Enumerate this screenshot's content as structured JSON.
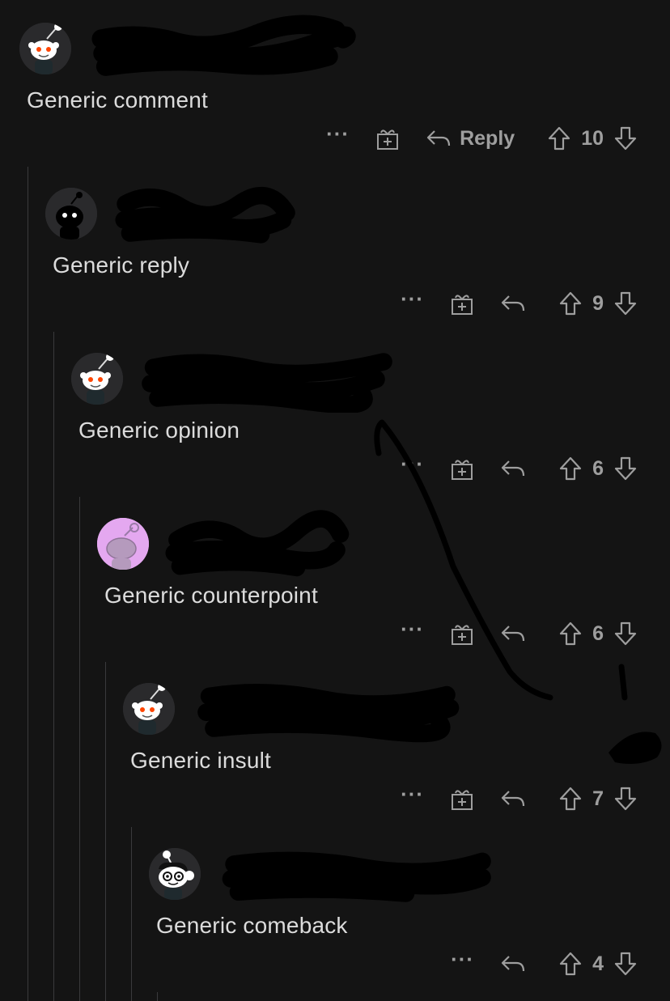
{
  "comments": [
    {
      "text": "Generic comment",
      "score": "10",
      "reply_label": "Reply",
      "more": "···",
      "avatar": "snoo-default-icon",
      "avatar_bg": "#2a2a2c"
    },
    {
      "text": "Generic reply",
      "score": "9",
      "reply_label": "",
      "more": "···",
      "avatar": "snoo-black-icon",
      "avatar_bg": "#2a2a2c"
    },
    {
      "text": "Generic opinion",
      "score": "6",
      "reply_label": "",
      "more": "···",
      "avatar": "snoo-default-icon",
      "avatar_bg": "#2a2a2c"
    },
    {
      "text": "Generic counterpoint",
      "score": "6",
      "reply_label": "",
      "more": "···",
      "avatar": "snoo-silhouette-icon",
      "avatar_bg": "#e4a8f0"
    },
    {
      "text": "Generic insult",
      "score": "7",
      "reply_label": "",
      "more": "···",
      "avatar": "snoo-default-icon",
      "avatar_bg": "#2a2a2c"
    },
    {
      "text": "Generic comeback",
      "score": "4",
      "reply_label": "",
      "more": "···",
      "avatar": "snoo-glasses-icon",
      "avatar_bg": "#2a2a2c"
    }
  ],
  "colors": {
    "background": "#141414",
    "text": "#dcdcdc",
    "muted": "#9e9e9e",
    "thread_line": "#3a3a3c"
  }
}
